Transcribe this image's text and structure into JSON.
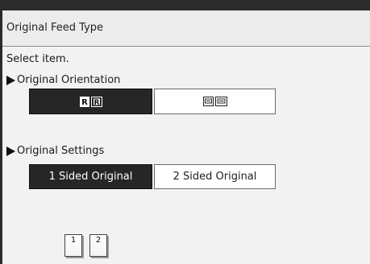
{
  "window": {
    "title": "Original Feed Type"
  },
  "content": {
    "prompt": "Select item."
  },
  "orientation": {
    "label": "Original Orientation",
    "options": [
      {
        "icon": "readable-direction-icon",
        "selected": true
      },
      {
        "icon": "unreadable-direction-icon",
        "selected": false
      }
    ]
  },
  "settings": {
    "label": "Original Settings",
    "options": [
      {
        "label": "1 Sided Original",
        "selected": true
      },
      {
        "label": "2 Sided Original",
        "selected": false
      }
    ]
  },
  "tray_icons": [
    {
      "label": "1"
    },
    {
      "label": "2"
    }
  ],
  "colors": {
    "selected_bg": "#262626",
    "button_bg": "#ffffff",
    "panel_bg": "#f2f2f2",
    "title_bg": "#ececec",
    "frame": "#2b2b2b"
  }
}
